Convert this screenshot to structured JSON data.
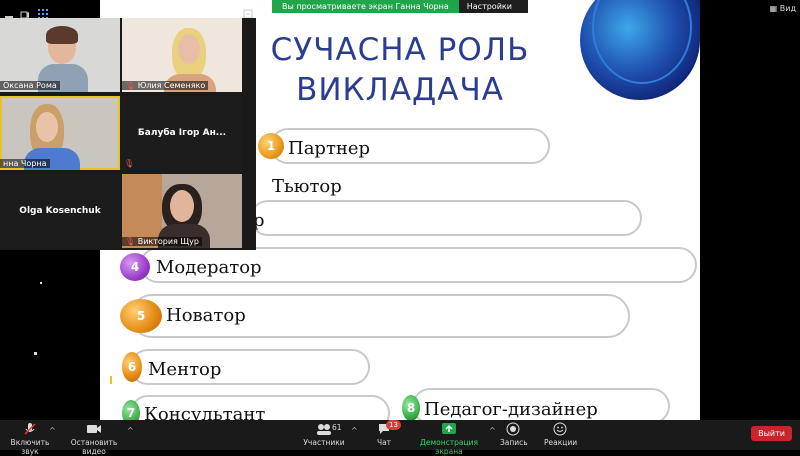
{
  "share_bar": {
    "viewing_text": "Вы просматриваете экран Ганна Чорна",
    "view_options": "Настройки просмотра ⌄"
  },
  "top_right": {
    "view_label": "Вид"
  },
  "gallery": {
    "tiles": [
      {
        "name": "Оксана Рома"
      },
      {
        "name": "Юлия Семеняко"
      },
      {
        "name": "нна Чорна"
      },
      {
        "name": "Балуба Ігор Ан..."
      },
      {
        "name": "Olga Kosenchuk"
      },
      {
        "name": "Виктория Щур"
      }
    ]
  },
  "slide": {
    "title_line1": "СУЧАСНА РОЛЬ",
    "title_line2": "ВИКЛАДАЧА",
    "items": [
      {
        "num": "1",
        "label": "Партнер"
      },
      {
        "num": "",
        "label": "Тьютор"
      },
      {
        "num": "",
        "label": "р"
      },
      {
        "num": "4",
        "label": "Модератор"
      },
      {
        "num": "5",
        "label": "Новатор"
      },
      {
        "num": "6",
        "label": "Ментор"
      },
      {
        "num": "7",
        "label": "Консультант"
      },
      {
        "num": "8",
        "label": "Педагог-дизайнер"
      }
    ]
  },
  "toolbar": {
    "unmute": "Включить звук",
    "stop_video": "Остановить видео",
    "participants": "Участники",
    "participants_count": "61",
    "chat": "Чат",
    "chat_badge": "13",
    "share_screen": "Демонстрация экрана",
    "record": "Запись",
    "reactions": "Реакции",
    "leave": "Выйти"
  },
  "colors": {
    "accent_green": "#1fa64a",
    "title_blue": "#2a3d8f",
    "leave_red": "#c7262d",
    "badge1": "#e89a1a",
    "badge4": "#9b3fc8",
    "badge5": "#e48a12",
    "badge6": "#e58a12",
    "badge7": "#38b04a",
    "badge8": "#38b04a"
  }
}
